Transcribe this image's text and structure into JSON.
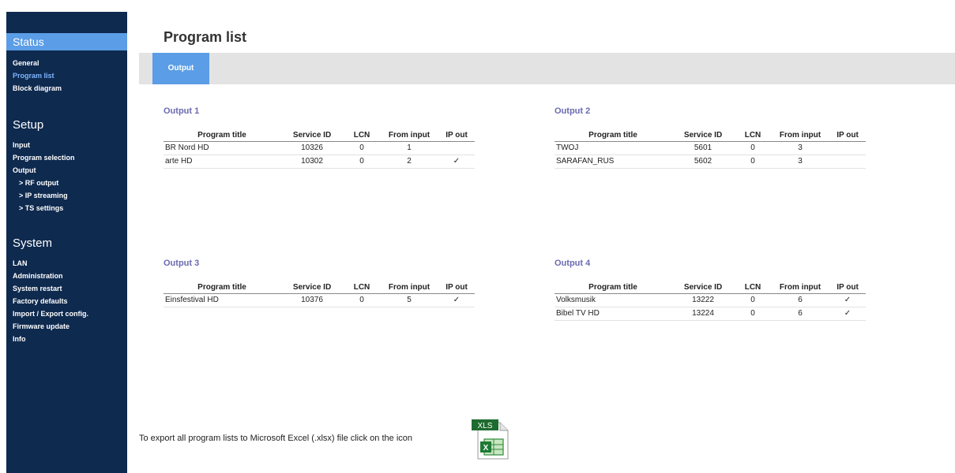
{
  "sidebar": {
    "status_header": "Status",
    "status_items": [
      "General",
      "Program list",
      "Block diagram"
    ],
    "setup_header": "Setup",
    "setup_items": [
      "Input",
      "Program selection",
      "Output",
      "> RF output",
      "> IP streaming",
      "> TS settings"
    ],
    "system_header": "System",
    "system_items": [
      "LAN",
      "Administration",
      "System restart",
      "Factory defaults",
      "Import / Export config.",
      "Firmware update",
      "Info"
    ]
  },
  "page": {
    "title": "Program list"
  },
  "tabs": {
    "output": "Output"
  },
  "columns": [
    "Program title",
    "Service ID",
    "LCN",
    "From input",
    "IP out"
  ],
  "outputs": [
    {
      "title": "Output 1",
      "rows": [
        {
          "title": "BR Nord HD",
          "sid": "10326",
          "lcn": "0",
          "from": "1",
          "ip": ""
        },
        {
          "title": "arte HD",
          "sid": "10302",
          "lcn": "0",
          "from": "2",
          "ip": "✓"
        }
      ]
    },
    {
      "title": "Output 2",
      "rows": [
        {
          "title": "TWOJ",
          "sid": "5601",
          "lcn": "0",
          "from": "3",
          "ip": ""
        },
        {
          "title": "SARAFAN_RUS",
          "sid": "5602",
          "lcn": "0",
          "from": "3",
          "ip": ""
        }
      ]
    },
    {
      "title": "Output 3",
      "rows": [
        {
          "title": "Einsfestival HD",
          "sid": "10376",
          "lcn": "0",
          "from": "5",
          "ip": "✓"
        }
      ]
    },
    {
      "title": "Output 4",
      "rows": [
        {
          "title": "Volksmusik",
          "sid": "13222",
          "lcn": "0",
          "from": "6",
          "ip": "✓"
        },
        {
          "title": "Bibel TV HD",
          "sid": "13224",
          "lcn": "0",
          "from": "6",
          "ip": "✓"
        }
      ]
    }
  ],
  "export": {
    "text": "To export all program lists to Microsoft Excel (.xlsx) file click on the icon",
    "icon_label": "XLS"
  },
  "colors": {
    "sidebar_bg": "#0f2a4f",
    "accent": "#5b9de6",
    "output_title": "#6a6ab0"
  }
}
